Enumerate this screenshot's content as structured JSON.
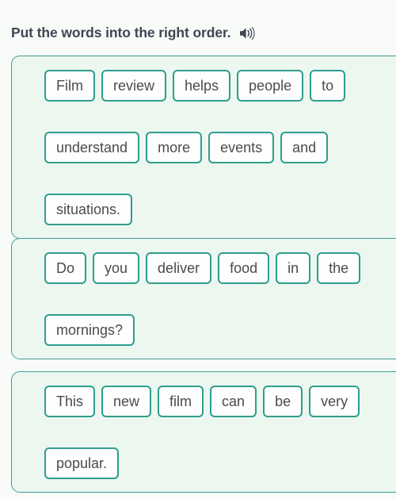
{
  "header": {
    "instruction": "Put the words into the right order.",
    "audio_icon": "speaker-icon"
  },
  "colors": {
    "page_background": "#f9fbf9",
    "card_background": "#ecf7f0",
    "card_border": "#3f9e91",
    "chip_border": "#2f9d8e",
    "chip_background": "#fdfefd",
    "chip_text": "#4b4b4b",
    "title_text": "#3f4652"
  },
  "exercises": [
    {
      "id": "sentence-1",
      "words": [
        "Film",
        "review",
        "helps",
        "people",
        "to",
        "understand",
        "more",
        "events",
        "and",
        "situations."
      ],
      "line_breaks_after": [
        4,
        8
      ]
    },
    {
      "id": "sentence-2",
      "words": [
        "Do",
        "you",
        "deliver",
        "food",
        "in",
        "the",
        "mornings?"
      ],
      "line_breaks_after": [
        5
      ]
    },
    {
      "id": "sentence-3",
      "words": [
        "This",
        "new",
        "film",
        "can",
        "be",
        "very",
        "popular."
      ],
      "line_breaks_after": [
        5
      ]
    }
  ]
}
